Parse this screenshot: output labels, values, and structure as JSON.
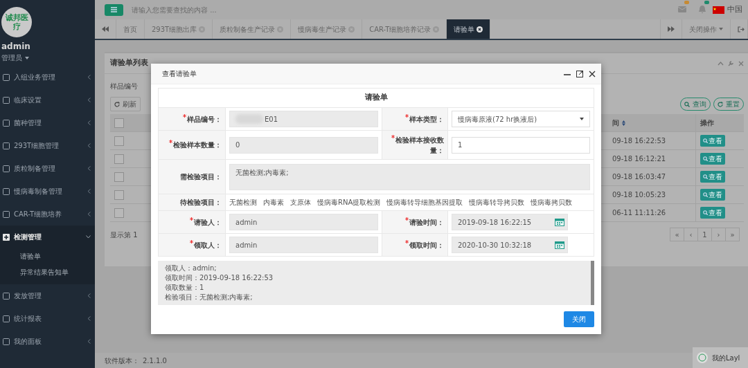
{
  "sidebar": {
    "logo_text": "诚邦医疗",
    "user": "admin",
    "role": "管理员",
    "items": [
      {
        "label": "入组业务管理",
        "expanded": false
      },
      {
        "label": "临床设置",
        "expanded": false
      },
      {
        "label": "菌种管理",
        "expanded": false
      },
      {
        "label": "293T细胞管理",
        "expanded": false
      },
      {
        "label": "质粒制备管理",
        "expanded": false
      },
      {
        "label": "慢病毒制备管理",
        "expanded": false
      },
      {
        "label": "CAR-T细胞培养",
        "expanded": false
      },
      {
        "label": "检测管理",
        "expanded": true,
        "children": [
          {
            "label": "请验单"
          },
          {
            "label": "异常结果告知单"
          }
        ]
      },
      {
        "label": "发放管理",
        "expanded": false
      },
      {
        "label": "统计报表",
        "expanded": false
      },
      {
        "label": "我的面板",
        "expanded": false
      }
    ]
  },
  "topbar": {
    "search_placeholder": "请输入您需要查找的内容 ...",
    "language": "中国"
  },
  "tabs": [
    {
      "label": "首页",
      "closable": false,
      "selected": false
    },
    {
      "label": "293T细胞出库",
      "closable": true,
      "selected": false
    },
    {
      "label": "质粒制备生产记录",
      "closable": true,
      "selected": false
    },
    {
      "label": "慢病毒生产记录",
      "closable": true,
      "selected": false
    },
    {
      "label": "CAR-T细胞培养记录",
      "closable": true,
      "selected": false
    },
    {
      "label": "请验单",
      "closable": true,
      "selected": true
    }
  ],
  "tab_actions": {
    "close_menu": "关闭操作"
  },
  "panel": {
    "title": "请验单列表",
    "filter_label": "样品编号",
    "refresh": "刷新",
    "search_buttons": [
      "查询",
      "重置"
    ],
    "columns": [
      "间",
      "操作"
    ],
    "all_checked": false,
    "rows": [
      {
        "checked": false,
        "time": "09-18 16:22:53",
        "action": "查看"
      },
      {
        "checked": false,
        "time": "09-18 16:12:21",
        "action": "查看"
      },
      {
        "checked": false,
        "time": "09-18 16:03:47",
        "action": "查看"
      },
      {
        "checked": false,
        "time": "09-18 10:05:23",
        "action": "查看"
      },
      {
        "checked": false,
        "time": "06-11 11:11:26",
        "action": "查看"
      }
    ],
    "summary": "显示第 1",
    "pages": [
      "«",
      "‹",
      "1",
      "›",
      "»"
    ]
  },
  "modal": {
    "title": "查看请验单",
    "form_title": "请验单",
    "rows": [
      [
        {
          "label": "样品编号：",
          "required": true,
          "kind": "text",
          "value": "E01",
          "disabled": true,
          "redacted": true
        },
        {
          "label": "样本类型：",
          "required": true,
          "kind": "select",
          "value": "慢病毒原液(72 hr换液后)",
          "disabled": false
        }
      ],
      [
        {
          "label": "检验样本数量：",
          "required": true,
          "kind": "text",
          "value": "0",
          "disabled": true
        },
        {
          "label": "检验样本接收数量：",
          "required": true,
          "kind": "text",
          "value": "1",
          "disabled": false
        }
      ],
      [
        {
          "label": "需检验项目：",
          "required": false,
          "kind": "textarea",
          "value": "无菌检测;内毒素;",
          "disabled": true
        }
      ],
      [
        {
          "label": "待检验项目：",
          "required": false,
          "kind": "options",
          "options": [
            "无菌检测",
            "内毒素",
            "支原体",
            "慢病毒RNA提取检测",
            "慢病毒转导细胞基因提取",
            "慢病毒转导拷贝数",
            "慢病毒拷贝数"
          ]
        }
      ],
      [
        {
          "label": "请验人：",
          "required": true,
          "kind": "text",
          "value": "admin",
          "disabled": true
        },
        {
          "label": "请验时间：",
          "required": true,
          "kind": "date",
          "value": "2019-09-18 16:22:15",
          "disabled": true
        }
      ],
      [
        {
          "label": "领取人：",
          "required": true,
          "kind": "text",
          "value": "admin",
          "disabled": true
        },
        {
          "label": "领取时间：",
          "required": true,
          "kind": "date",
          "value": "2020-10-30 10:32:18",
          "disabled": true
        }
      ]
    ],
    "log": [
      "领取人：admin;",
      "领取时间：2019-09-18 16:22:53",
      "领取数量：1",
      "检验项目：无菌检测;内毒素;"
    ],
    "close_button": "关闭"
  },
  "footer": {
    "version_label": "软件版本：",
    "version": "2.1.1.0"
  },
  "chat_widget": {
    "label": "我的Layl"
  }
}
